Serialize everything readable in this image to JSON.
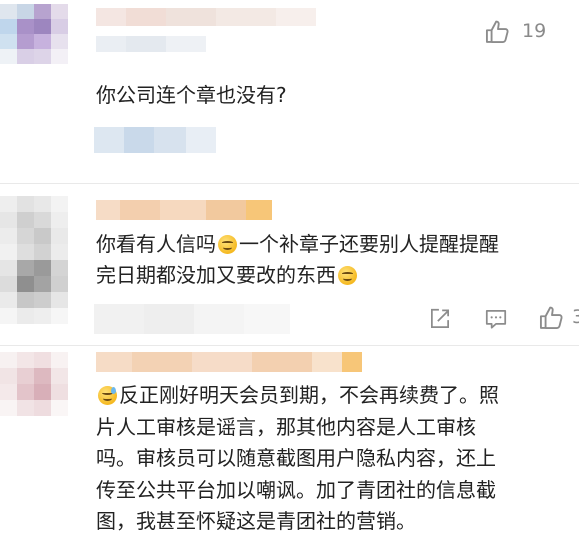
{
  "comments": [
    {
      "text_lines": [
        "你公司连个章也没有?"
      ],
      "likes": "19"
    },
    {
      "text_parts": {
        "line1_a": "你看有人信吗",
        "line1_b": "一个补章子还要别人提醒提醒",
        "line2_a": "完日期都没加又要改的东西"
      },
      "likes": "3"
    },
    {
      "text_parts": {
        "line1": "反正刚好明天会员到期，不会再续费了。照",
        "line2": "片人工审核是谣言，那其他内容是人工审核",
        "line3": "吗。审核员可以随意截图用户隐私内容，还上",
        "line4": "传至公共平台加以嘲讽。加了青团社的信息截",
        "line5": "图，我甚至怀疑这是青团社的营销。"
      }
    }
  ],
  "icons": {
    "like": "thumbs-up-icon",
    "share": "share-icon",
    "comment": "comment-icon",
    "emoji_smile": "smiling-face-emoji",
    "emoji_sweat": "sweat-smile-emoji"
  },
  "colors": {
    "text": "#222222",
    "meta": "#8a8a8a",
    "icon": "#8c8c8c",
    "divider": "#e9e9e9"
  }
}
